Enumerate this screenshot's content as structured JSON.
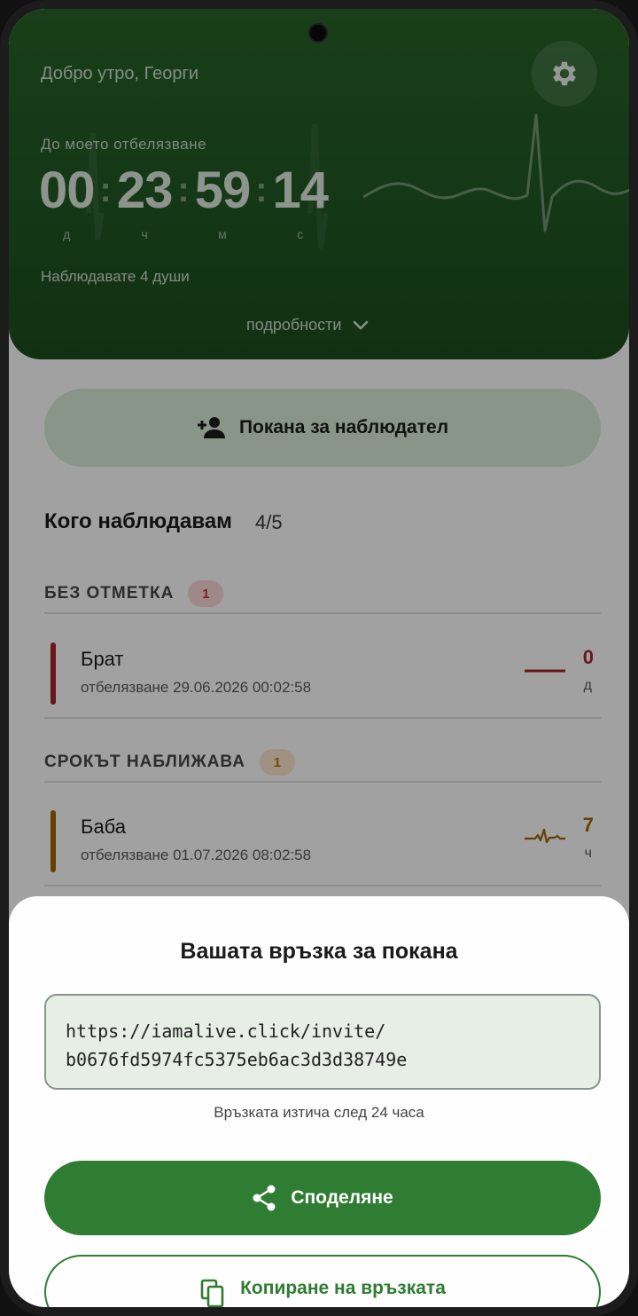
{
  "header": {
    "greeting": "Добро утро, Георги",
    "until_label": "До моето отбелязване",
    "timer": {
      "days": "00",
      "hours": "23",
      "minutes": "59",
      "seconds": "14",
      "days_label": "д",
      "hours_label": "ч",
      "minutes_label": "м",
      "seconds_label": "с"
    },
    "watching": "Наблюдавате 4 души",
    "details_label": "подробности"
  },
  "invite_button": {
    "label": "Покана за наблюдател"
  },
  "watched": {
    "title": "Кого наблюдавам",
    "count": "4/5",
    "groups": [
      {
        "title": "БЕЗ ОТМЕТКА",
        "badge": "1",
        "color": "#a32424",
        "items": [
          {
            "name": "Брат",
            "sub": "отбелязване 29.06.2026 00:02:58",
            "value": "0",
            "unit": "д"
          }
        ]
      },
      {
        "title": "СРОКЪТ НАБЛИЖАВА",
        "badge": "1",
        "color": "#9a6200",
        "items": [
          {
            "name": "Баба",
            "sub": "отбелязване 01.07.2026 08:02:58",
            "value": "7",
            "unit": "ч"
          }
        ]
      }
    ]
  },
  "sheet": {
    "title": "Вашата връзка за покана",
    "link_line1": "https://iamalive.click/invite/",
    "link_line2": "b0676fd5974fc5375eb6ac3d3d38749e",
    "expire_note": "Връзката изтича след 24 часа",
    "share_label": "Споделяне",
    "copy_label": "Копиране на връзката"
  },
  "icons": {
    "settings": "gear-icon",
    "details": "chevron-down-icon",
    "invite": "person-add-icon",
    "share": "share-icon",
    "copy": "copy-icon"
  },
  "colors": {
    "primary": "#2f7d32",
    "header": "#235a24",
    "alert": "#a32424",
    "warning": "#9a6200"
  }
}
